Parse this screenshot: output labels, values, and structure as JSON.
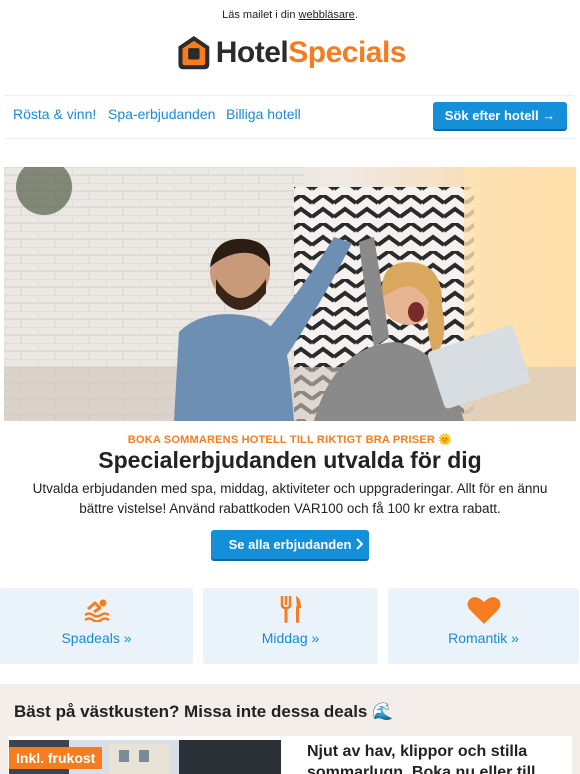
{
  "preheader": {
    "text": "Läs mailet i din ",
    "link": "webbläsare",
    "suffix": "."
  },
  "brand": {
    "part1": "Hotel",
    "part2": "Specials",
    "accent_color": "#f57c1f",
    "dark_color": "#2b2b2b"
  },
  "nav": {
    "links": [
      "Rösta & vinn!",
      "Spa-erbjudanden",
      "Billiga hotell"
    ],
    "search_button": "Sök efter hotell →"
  },
  "hero": {
    "image": "two-people-high-five-photo"
  },
  "promo": {
    "eyebrow": "BOKA SOMMARENS HOTELL TILL RIKTIGT BRA PRISER 🌞",
    "headline": "Specialerbjudanden utvalda för dig",
    "body": "Utvalda erbjudanden med spa, middag, aktiviteter och uppgraderingar. Allt för en ännu bättre vistelse! Använd rabattkoden VAR100 och få 100 kr extra rabatt.",
    "cta": "Se alla erbjudanden"
  },
  "categories": [
    {
      "label": "Spadeals »",
      "icon": "swimmer-icon"
    },
    {
      "label": "Middag »",
      "icon": "fork-knife-icon"
    },
    {
      "label": "Romantik »",
      "icon": "heart-icon"
    }
  ],
  "west_coast": {
    "title": "Bäst på västkusten? Missa inte dessa deals 🌊",
    "badge": "Inkl. frukost",
    "card_text": "Njut av hav, klippor och stilla sommarlugn. Boka nu eller till"
  },
  "colors": {
    "blue": "#1590d8",
    "link_blue": "#1a8ad6",
    "orange": "#f57c1f",
    "tile_bg": "#eaf3f9",
    "beige": "#f3eee9"
  }
}
